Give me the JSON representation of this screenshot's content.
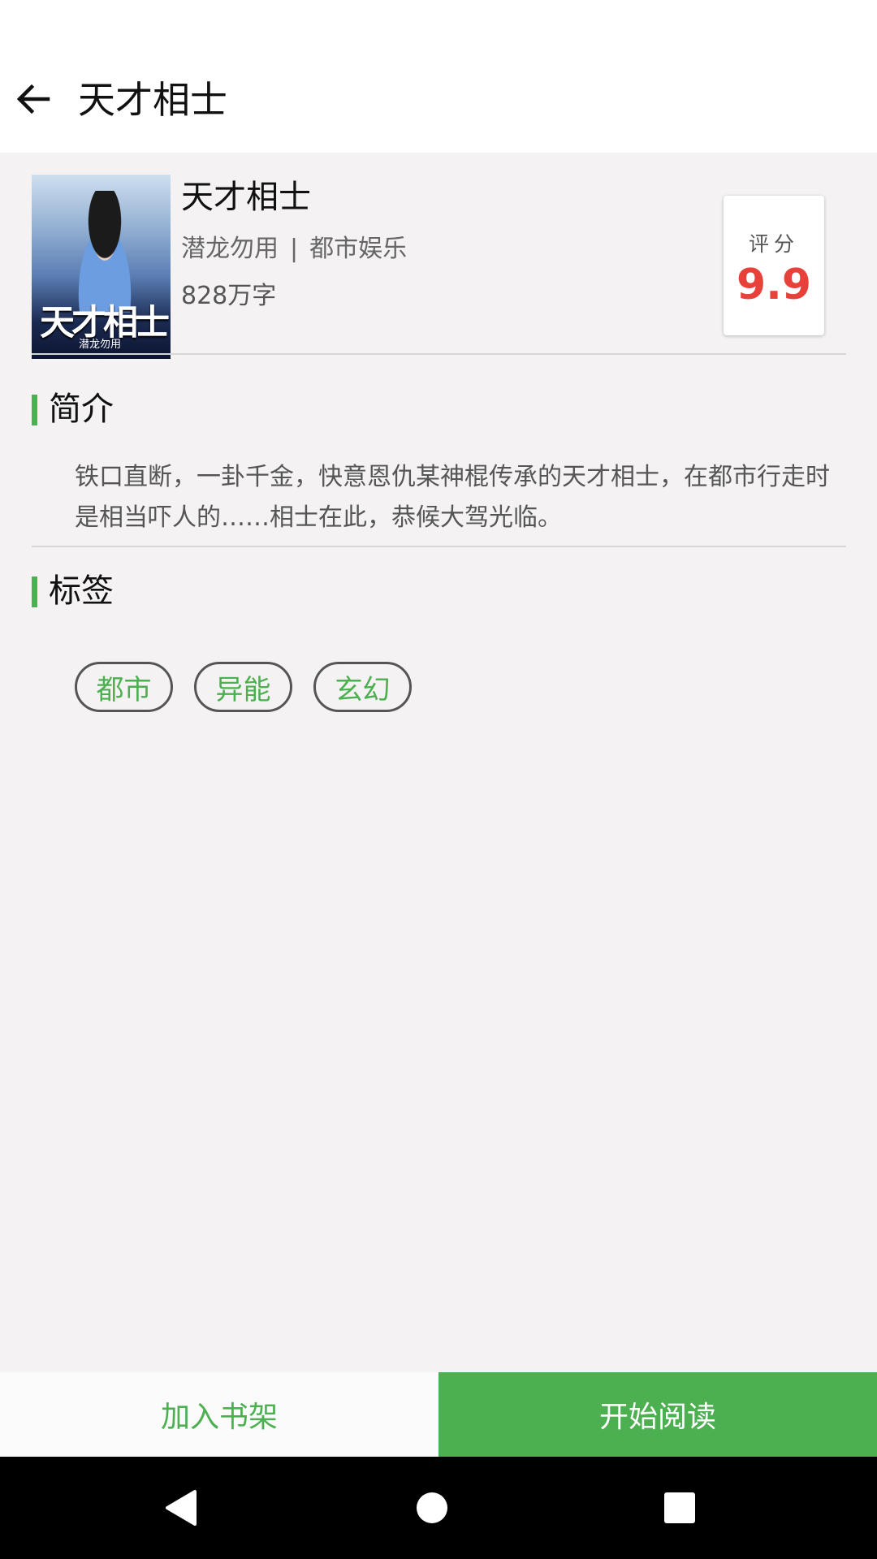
{
  "header": {
    "title": "天才相士",
    "back_icon": "arrow-left-icon"
  },
  "book": {
    "cover": {
      "title_text": "天才相士",
      "author_text": "潜龙勿用"
    },
    "title": "天才相士",
    "author": "潜龙勿用",
    "separator": "|",
    "category": "都市娱乐",
    "word_count": "828万字",
    "rating_label": "评分",
    "rating_value": "9.9"
  },
  "intro": {
    "heading": "简介",
    "text": "铁口直断，一卦千金，快意恩仇某神棍传承的天才相士，在都市行走时是相当吓人的……相士在此，恭候大驾光临。"
  },
  "tags_section": {
    "heading": "标签",
    "tags": [
      "都市",
      "异能",
      "玄幻"
    ]
  },
  "actions": {
    "add_shelf": "加入书架",
    "start_reading": "开始阅读"
  },
  "navbar": {
    "back_icon": "nav-back-triangle-icon",
    "home_icon": "nav-home-circle-icon",
    "recents_icon": "nav-recents-square-icon"
  },
  "colors": {
    "accent": "#4caf50",
    "rating": "#e8413a",
    "background": "#f4f2f3"
  }
}
